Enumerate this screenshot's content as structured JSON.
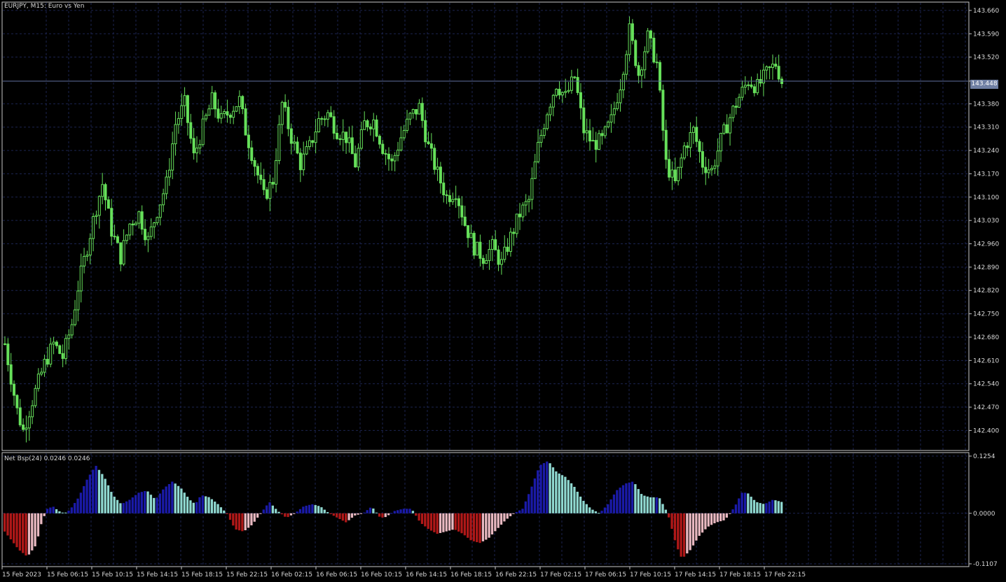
{
  "window": {
    "symbol_caption": "EURJPY, M15:  Euro vs Yen",
    "indicator_caption": "Net Bsp(24) 0.0246 0.0246",
    "current_price_label": "143.448"
  },
  "colors": {
    "background": "#000000",
    "grid": "#1c2450",
    "axis": "#c8c8c8",
    "text": "#d8d8d8",
    "candle": "#66e05a",
    "bid_line": "#5f6f9f",
    "hist_positive_rising": "#1a1aa8",
    "hist_positive_falling": "#8fd8d0",
    "hist_negative_falling": "#b01818",
    "hist_negative_rising": "#e8b8c0"
  },
  "chart_data": [
    {
      "type": "candlestick",
      "title": "EURJPY, M15:  Euro vs Yen",
      "ylim": [
        142.34,
        143.685
      ],
      "y_ticks": [
        "143.660",
        "143.590",
        "143.520",
        "143.448",
        "143.380",
        "143.310",
        "143.240",
        "143.170",
        "143.100",
        "143.030",
        "142.960",
        "142.890",
        "142.820",
        "142.750",
        "142.680",
        "142.610",
        "142.540",
        "142.470",
        "142.400"
      ],
      "x_tick_labels": [
        "15 Feb 2023",
        "15 Feb 06:15",
        "15 Feb 10:15",
        "15 Feb 14:15",
        "15 Feb 18:15",
        "15 Feb 22:15",
        "16 Feb 02:15",
        "16 Feb 06:15",
        "16 Feb 10:15",
        "16 Feb 14:15",
        "16 Feb 18:15",
        "16 Feb 22:15",
        "17 Feb 02:15",
        "17 Feb 06:15",
        "17 Feb 10:15",
        "17 Feb 14:15",
        "17 Feb 18:15",
        "17 Feb 22:15"
      ],
      "grid": true,
      "current_price": 143.448,
      "close_path": [
        [
          0,
          142.66
        ],
        [
          4,
          142.46
        ],
        [
          6,
          142.4
        ],
        [
          9,
          142.49
        ],
        [
          13,
          142.6
        ],
        [
          16,
          142.66
        ],
        [
          19,
          142.62
        ],
        [
          22,
          142.72
        ],
        [
          24,
          142.83
        ],
        [
          27,
          142.95
        ],
        [
          30,
          143.07
        ],
        [
          32,
          143.14
        ],
        [
          35,
          143.0
        ],
        [
          38,
          142.92
        ],
        [
          41,
          143.02
        ],
        [
          44,
          143.05
        ],
        [
          47,
          142.97
        ],
        [
          50,
          143.06
        ],
        [
          53,
          143.14
        ],
        [
          56,
          143.32
        ],
        [
          59,
          143.38
        ],
        [
          62,
          143.22
        ],
        [
          65,
          143.31
        ],
        [
          68,
          143.39
        ],
        [
          71,
          143.33
        ],
        [
          74,
          143.36
        ],
        [
          77,
          143.39
        ],
        [
          79,
          143.3
        ],
        [
          82,
          143.2
        ],
        [
          85,
          143.1
        ],
        [
          88,
          143.15
        ],
        [
          91,
          143.38
        ],
        [
          94,
          143.28
        ],
        [
          97,
          143.2
        ],
        [
          100,
          143.25
        ],
        [
          103,
          143.33
        ],
        [
          106,
          143.35
        ],
        [
          109,
          143.3
        ],
        [
          112,
          143.28
        ],
        [
          115,
          143.2
        ],
        [
          118,
          143.32
        ],
        [
          121,
          143.33
        ],
        [
          124,
          143.25
        ],
        [
          127,
          143.2
        ],
        [
          130,
          143.28
        ],
        [
          133,
          143.34
        ],
        [
          136,
          143.37
        ],
        [
          139,
          143.25
        ],
        [
          142,
          143.17
        ],
        [
          145,
          143.1
        ],
        [
          148,
          143.12
        ],
        [
          151,
          143.02
        ],
        [
          154,
          142.95
        ],
        [
          157,
          142.92
        ],
        [
          160,
          142.95
        ],
        [
          163,
          142.9
        ],
        [
          166,
          142.98
        ],
        [
          169,
          143.05
        ],
        [
          172,
          143.09
        ],
        [
          175,
          143.25
        ],
        [
          178,
          143.36
        ],
        [
          181,
          143.44
        ],
        [
          184,
          143.4
        ],
        [
          187,
          143.46
        ],
        [
          190,
          143.3
        ],
        [
          193,
          143.26
        ],
        [
          196,
          143.27
        ],
        [
          199,
          143.33
        ],
        [
          202,
          143.44
        ],
        [
          205,
          143.6
        ],
        [
          208,
          143.47
        ],
        [
          211,
          143.58
        ],
        [
          214,
          143.5
        ],
        [
          217,
          143.2
        ],
        [
          220,
          143.14
        ],
        [
          223,
          143.25
        ],
        [
          226,
          143.3
        ],
        [
          229,
          143.2
        ],
        [
          232,
          143.18
        ],
        [
          235,
          143.27
        ],
        [
          238,
          143.34
        ],
        [
          241,
          143.4
        ],
        [
          244,
          143.45
        ],
        [
          247,
          143.43
        ],
        [
          250,
          143.47
        ],
        [
          253,
          143.5
        ],
        [
          255,
          143.448
        ]
      ]
    },
    {
      "type": "histogram",
      "title": "Net Bsp(24) 0.0246 0.0246",
      "ylim": [
        -0.1107,
        0.1254
      ],
      "y_ticks": [
        "0.1254",
        "0.0000",
        "-0.1107"
      ],
      "current_value": 0.0246,
      "value_path": [
        [
          0,
          -0.04
        ],
        [
          5,
          -0.08
        ],
        [
          8,
          -0.095
        ],
        [
          11,
          -0.07
        ],
        [
          13,
          -0.02
        ],
        [
          15,
          0.01
        ],
        [
          17,
          0.015
        ],
        [
          19,
          0.005
        ],
        [
          21,
          0.0
        ],
        [
          23,
          0.008
        ],
        [
          26,
          0.035
        ],
        [
          29,
          0.075
        ],
        [
          32,
          0.105
        ],
        [
          35,
          0.08
        ],
        [
          38,
          0.04
        ],
        [
          41,
          0.02
        ],
        [
          44,
          0.03
        ],
        [
          47,
          0.045
        ],
        [
          50,
          0.05
        ],
        [
          53,
          0.03
        ],
        [
          56,
          0.055
        ],
        [
          59,
          0.07
        ],
        [
          62,
          0.055
        ],
        [
          65,
          0.03
        ],
        [
          67,
          0.02
        ],
        [
          69,
          0.04
        ],
        [
          72,
          0.035
        ],
        [
          75,
          0.02
        ],
        [
          78,
          0.0
        ],
        [
          81,
          -0.035
        ],
        [
          84,
          -0.04
        ],
        [
          87,
          -0.025
        ],
        [
          90,
          0.0
        ],
        [
          93,
          0.025
        ],
        [
          96,
          0.005
        ],
        [
          99,
          -0.01
        ],
        [
          102,
          0.0
        ],
        [
          105,
          0.015
        ],
        [
          108,
          0.02
        ],
        [
          111,
          0.015
        ],
        [
          114,
          0.0
        ],
        [
          117,
          -0.01
        ],
        [
          120,
          -0.02
        ],
        [
          123,
          -0.005
        ],
        [
          126,
          0.0
        ],
        [
          129,
          0.015
        ],
        [
          132,
          -0.01
        ],
        [
          134,
          -0.008
        ],
        [
          137,
          0.005
        ],
        [
          140,
          0.01
        ],
        [
          143,
          0.01
        ],
        [
          146,
          -0.02
        ],
        [
          149,
          -0.035
        ],
        [
          152,
          -0.045
        ],
        [
          155,
          -0.04
        ],
        [
          158,
          -0.035
        ],
        [
          161,
          -0.045
        ],
        [
          164,
          -0.06
        ],
        [
          167,
          -0.065
        ],
        [
          170,
          -0.055
        ],
        [
          173,
          -0.035
        ],
        [
          176,
          -0.015
        ],
        [
          179,
          0.0
        ],
        [
          182,
          0.01
        ],
        [
          185,
          0.055
        ],
        [
          188,
          0.105
        ],
        [
          191,
          0.115
        ],
        [
          194,
          0.09
        ],
        [
          197,
          0.08
        ],
        [
          200,
          0.06
        ],
        [
          203,
          0.03
        ],
        [
          206,
          0.01
        ],
        [
          209,
          0.0
        ],
        [
          212,
          0.02
        ],
        [
          215,
          0.05
        ],
        [
          218,
          0.065
        ],
        [
          221,
          0.07
        ],
        [
          224,
          0.04
        ],
        [
          227,
          0.035
        ],
        [
          230,
          0.035
        ],
        [
          233,
          0.0
        ],
        [
          236,
          -0.07
        ],
        [
          238,
          -0.1
        ],
        [
          241,
          -0.08
        ],
        [
          244,
          -0.05
        ],
        [
          247,
          -0.03
        ],
        [
          250,
          -0.02
        ],
        [
          253,
          -0.015
        ],
        [
          255,
          0.0
        ],
        [
          257,
          0.02
        ],
        [
          259,
          0.045
        ],
        [
          261,
          0.045
        ],
        [
          264,
          0.025
        ],
        [
          267,
          0.02
        ],
        [
          270,
          0.03
        ],
        [
          273,
          0.025
        ]
      ]
    }
  ]
}
